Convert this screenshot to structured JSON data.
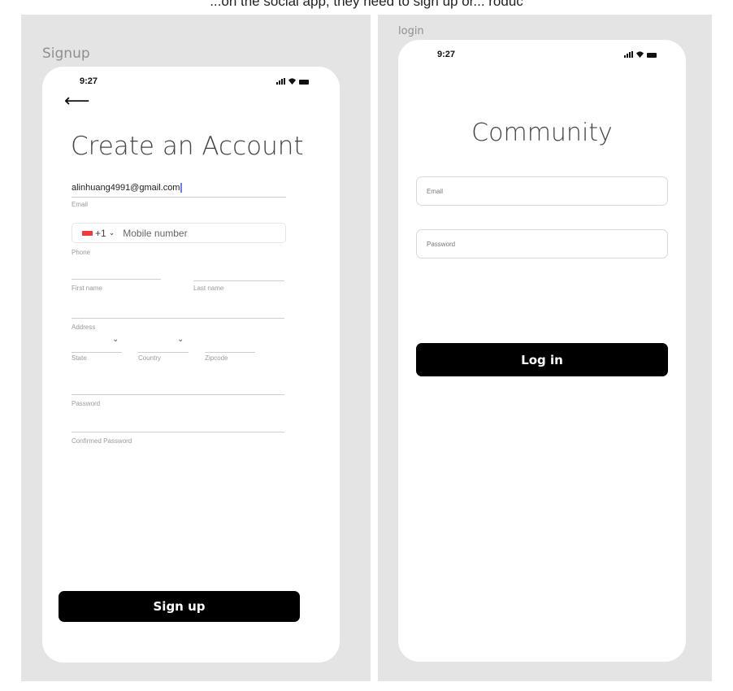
{
  "caption": "...on the social app, they need to sign up or... roduc",
  "signup": {
    "frame_label": "Signup",
    "status_time": "9:27",
    "title": "Create an Account",
    "email_value": "alinhuang4991@gmail.com",
    "email_label": "Email",
    "country_code": "+1",
    "mobile_placeholder": "Mobile number",
    "phone_label": "Phone",
    "first_name_label": "First name",
    "last_name_label": "Last name",
    "address_label": "Address",
    "state_label": "State",
    "country_label": "Country",
    "zipcode_label": "Zipcode",
    "password_label": "Password",
    "confirm_password_label": "Confirmed Password",
    "button_label": "Sign up"
  },
  "login": {
    "frame_label": "login",
    "status_time": "9:27",
    "title": "Community",
    "email_placeholder": "Email",
    "password_placeholder": "Password",
    "button_label": "Log in"
  },
  "colors": {
    "artboard": "#e4e4e4",
    "button": "#000000",
    "flag": "#f03a3a",
    "caret": "#6c7bff"
  }
}
